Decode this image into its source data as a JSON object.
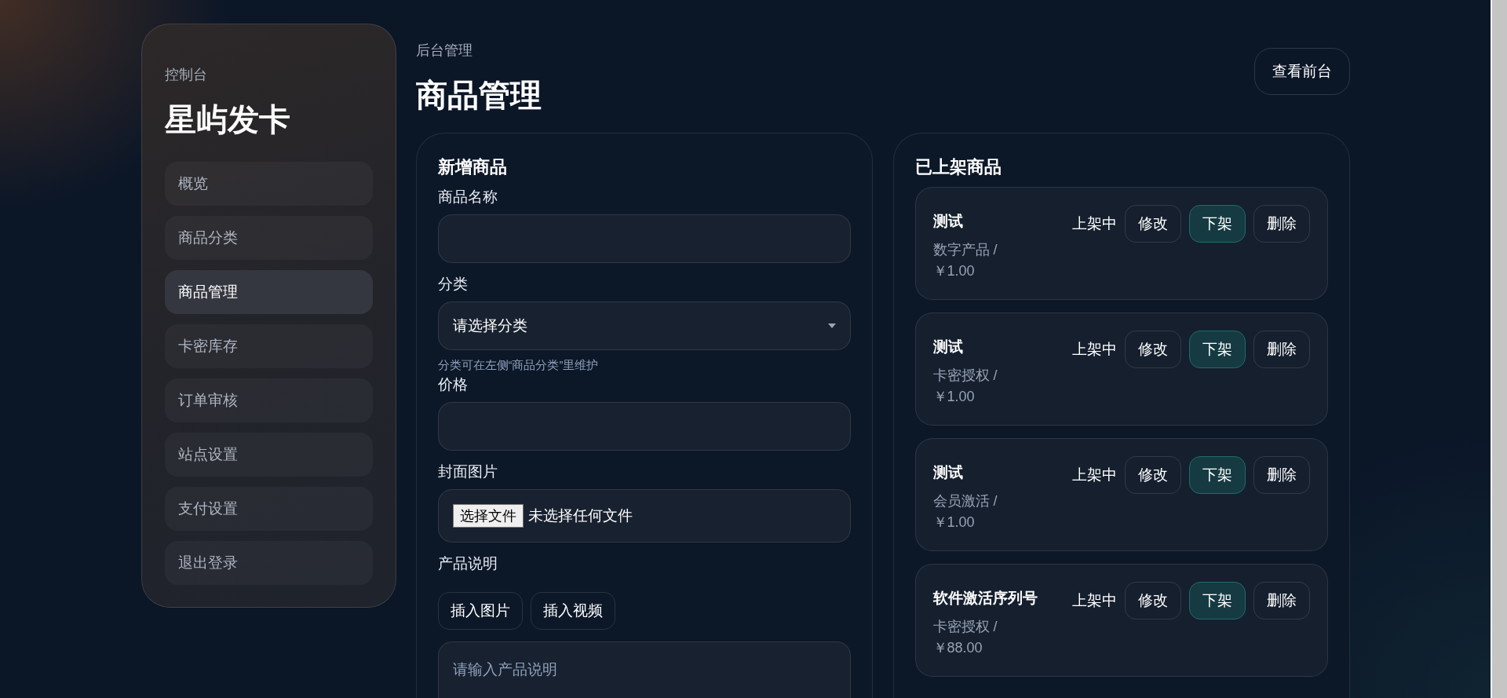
{
  "sidebar": {
    "eyebrow": "控制台",
    "brand": "星屿发卡",
    "items": [
      {
        "label": "概览",
        "selected": false
      },
      {
        "label": "商品分类",
        "selected": false
      },
      {
        "label": "商品管理",
        "selected": true
      },
      {
        "label": "卡密库存",
        "selected": false
      },
      {
        "label": "订单审核",
        "selected": false
      },
      {
        "label": "站点设置",
        "selected": false
      },
      {
        "label": "支付设置",
        "selected": false
      },
      {
        "label": "退出登录",
        "selected": false
      }
    ]
  },
  "header": {
    "breadcrumb": "后台管理",
    "title": "商品管理",
    "action": "查看前台"
  },
  "form": {
    "title": "新增商品",
    "fields": [
      {
        "kind": "input",
        "label": "商品名称"
      },
      {
        "kind": "select",
        "label": "分类",
        "value": "请选择分类",
        "hint": "分类可在左侧“商品分类”里维护"
      },
      {
        "kind": "input",
        "label": "价格"
      },
      {
        "kind": "file",
        "label": "封面图片",
        "button": "选择文件",
        "value": "未选择任何文件"
      },
      {
        "kind": "editor",
        "label": "产品说明",
        "tools": [
          "插入图片",
          "插入视频"
        ],
        "placeholder": "请输入产品说明"
      }
    ]
  },
  "products": {
    "title": "已上架商品",
    "items": [
      {
        "name": "测试",
        "category": "数字产品 /",
        "price": "￥1.00",
        "status": "上架中",
        "actions": [
          "修改",
          "下架",
          "删除"
        ]
      },
      {
        "name": "测试",
        "category": "卡密授权 /",
        "price": "￥1.00",
        "status": "上架中",
        "actions": [
          "修改",
          "下架",
          "删除"
        ]
      },
      {
        "name": "测试",
        "category": "会员激活 /",
        "price": "￥1.00",
        "status": "上架中",
        "actions": [
          "修改",
          "下架",
          "删除"
        ]
      },
      {
        "name": "软件激活序列号",
        "category": "卡密授权 /",
        "price": "￥88.00",
        "status": "上架中",
        "actions": [
          "修改",
          "下架",
          "删除"
        ]
      }
    ]
  }
}
